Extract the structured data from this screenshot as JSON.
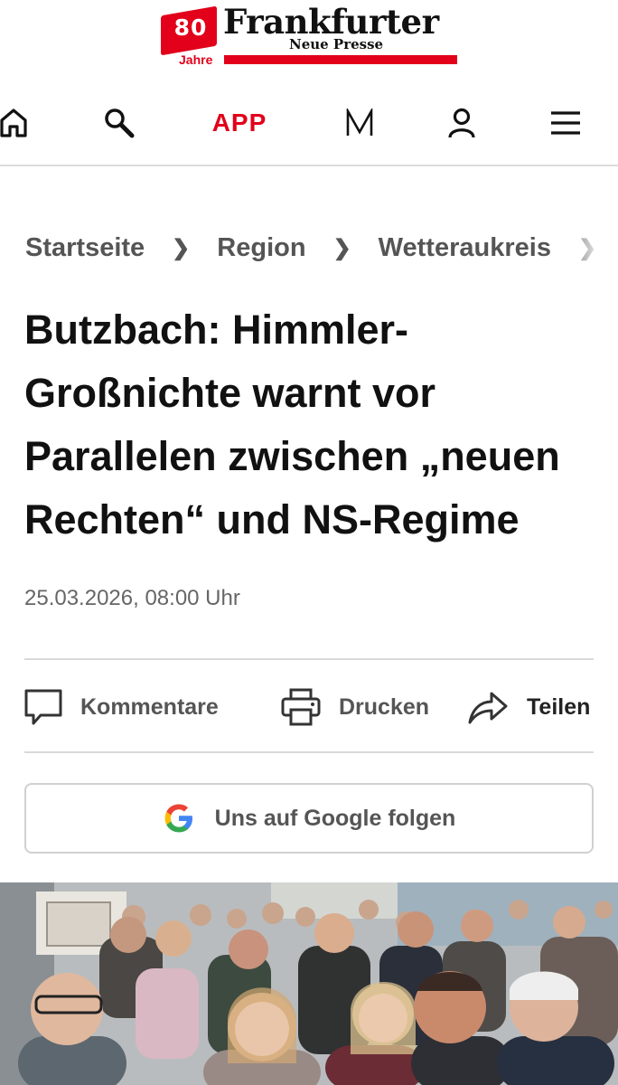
{
  "masthead": {
    "anniversary_number": "80",
    "anniversary_label": "Jahre",
    "brand_name": "Frankfurter",
    "brand_subtitle": "Neue Presse",
    "accent_color": "#e2001a"
  },
  "nav": {
    "home_icon": "home-icon",
    "search_icon": "search-icon",
    "app_label": "APP",
    "m_label": "M",
    "account_icon": "user-icon",
    "menu_icon": "hamburger-menu-icon"
  },
  "breadcrumb": {
    "items": [
      "Startseite",
      "Region",
      "Wetteraukreis"
    ],
    "separator": "❯"
  },
  "article": {
    "headline": "Butzbach: Himmler-Großnichte warnt vor Parallelen zwischen „neuen Rechten“ und NS-Regime",
    "date": "25.03.2026, 08:00 Uhr"
  },
  "actions": {
    "comments_label": "Kommentare",
    "print_label": "Drucken",
    "share_label": "Teilen"
  },
  "google_follow": {
    "label": "Uns auf Google folgen"
  }
}
